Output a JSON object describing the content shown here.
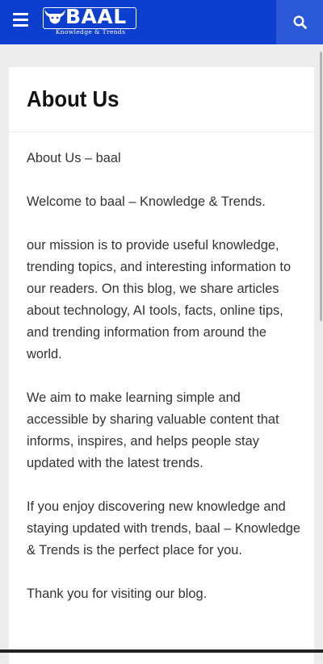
{
  "header": {
    "logo_text": "BAAL",
    "logo_tagline": "Knowledge & Trends",
    "menu_icon": "hamburger-menu-icon",
    "search_icon": "search-icon",
    "colors": {
      "header_bg": "#0c3fd0",
      "search_bg": "#2b58d9"
    }
  },
  "page": {
    "title": "About Us",
    "paragraphs": [
      "About Us – baal",
      "Welcome to baal – Knowledge & Trends.",
      "our mission is to provide useful knowledge, trending topics, and interesting information to our readers. On this blog, we share articles about technology, AI tools, facts, online tips, and trending information from around the world.",
      "We aim to make learning simple and accessible by sharing valuable content that informs, inspires, and helps people stay updated with the latest trends.",
      "If you enjoy discovering new knowledge and staying updated with trends, baal – Knowledge & Trends is the perfect place for you.",
      "Thank you for visiting our blog."
    ]
  }
}
